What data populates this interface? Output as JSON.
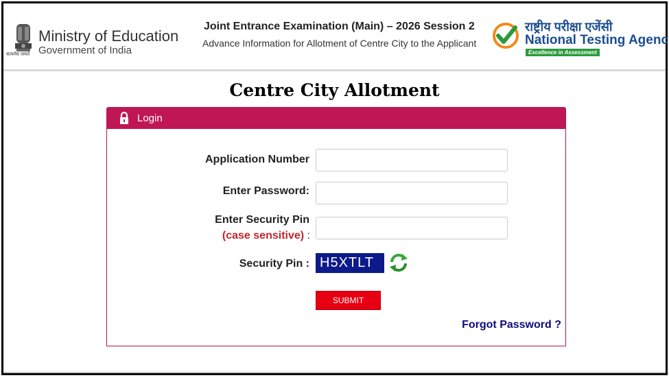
{
  "header": {
    "ministry_title": "Ministry of Education",
    "ministry_sub": "Government of India",
    "emblem_caption": "सत्यमेव जयते",
    "exam_title": "Joint Entrance Examination (Main) – 2026 Session 2",
    "exam_sub": "Advance Information for Allotment of Centre City to the Applicant",
    "nta_hindi": "राष्ट्रीय परीक्षा एजेंसी",
    "nta_name": "National Testing Agency",
    "nta_tagline": "Excellence in Assessment"
  },
  "page_title": "Centre City Allotment",
  "login": {
    "panel_title": "Login",
    "fields": {
      "application_number": {
        "label": "Application Number",
        "value": "",
        "placeholder": ""
      },
      "password": {
        "label": "Enter Password:",
        "value": "",
        "placeholder": ""
      },
      "security_pin": {
        "label": "Enter Security Pin",
        "note": "(case sensitive)",
        "colon": ":",
        "value": "",
        "placeholder": ""
      }
    },
    "captcha_label": "Security Pin :",
    "captcha_value": "H5XTLT",
    "submit_label": "SUBMIT",
    "forgot_label": "Forgot Password ?"
  },
  "colors": {
    "panel_header": "#c01655",
    "submit": "#e60012",
    "captcha_bg": "#0d1a8a",
    "link": "#0b0b7a",
    "nta_blue": "#1a4d8f",
    "nta_green": "#2a9a3c"
  },
  "icons": {
    "emblem": "national-emblem-icon",
    "nta": "nta-checkmark-logo-icon",
    "lock": "lock-icon",
    "refresh": "refresh-captcha-icon"
  }
}
